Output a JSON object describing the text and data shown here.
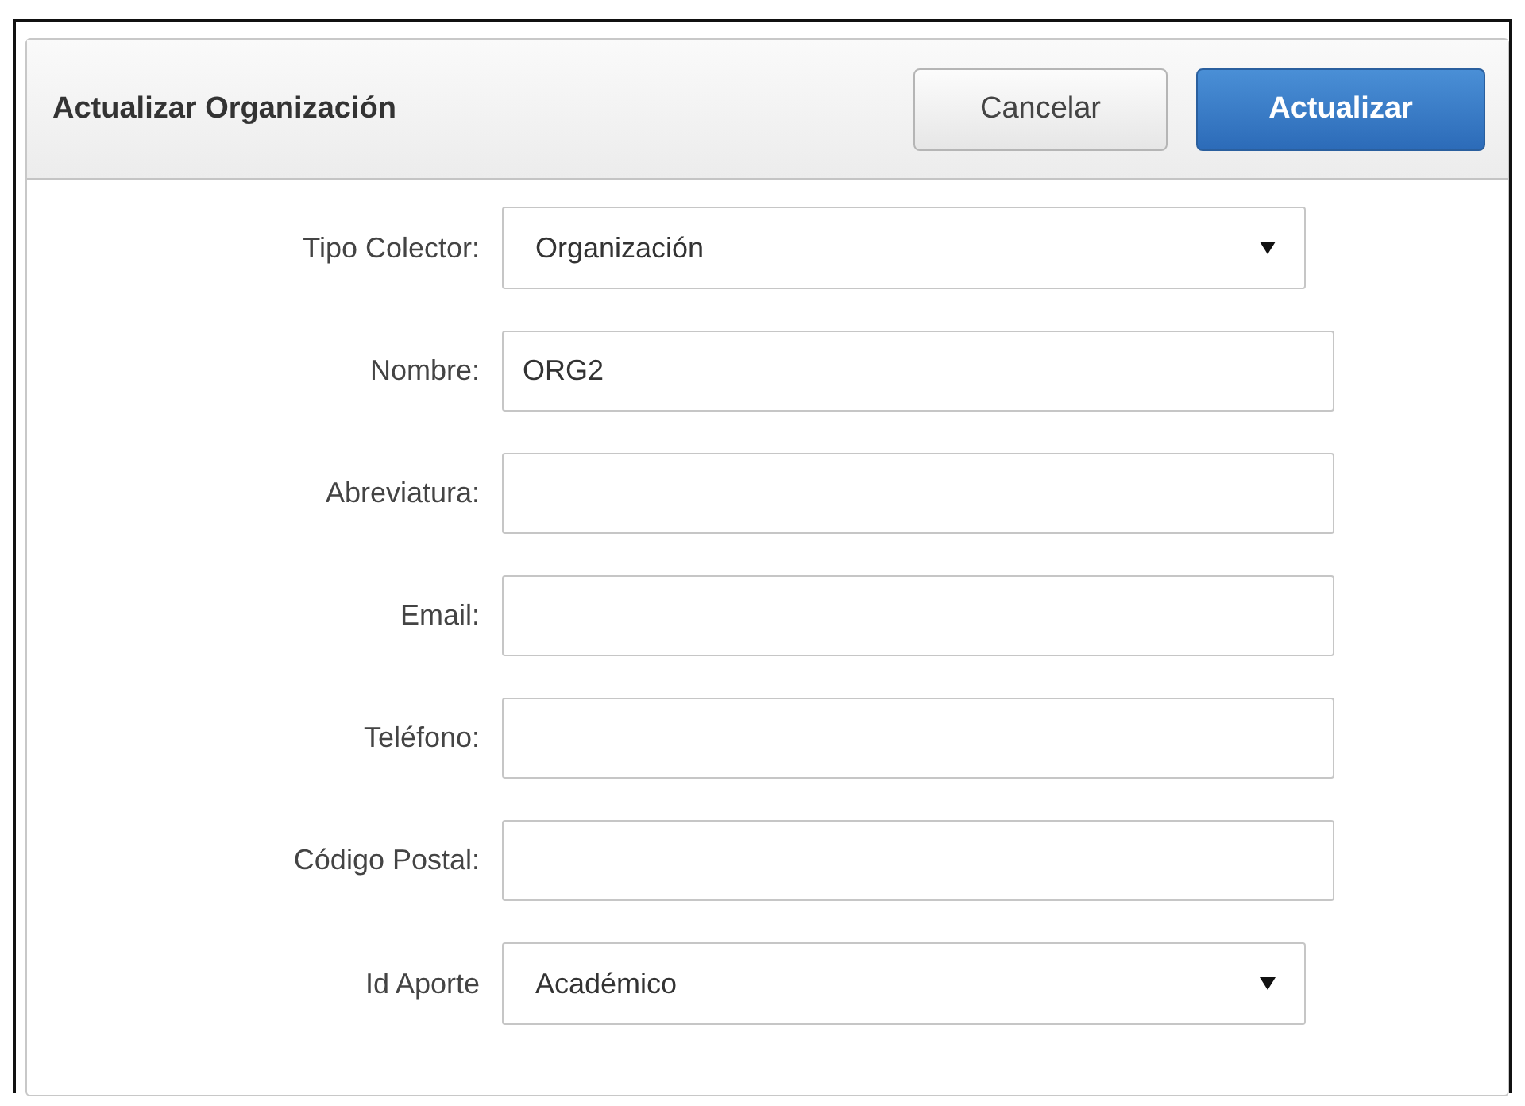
{
  "dialog": {
    "title": "Actualizar Organización"
  },
  "buttons": [
    {
      "label": "Cancelar",
      "kind": "default"
    },
    {
      "label": "Actualizar",
      "kind": "primary"
    }
  ],
  "fields": [
    {
      "label": "Tipo Colector:",
      "kind": "select",
      "value": "Organización"
    },
    {
      "label": "Nombre:",
      "kind": "text",
      "value": "ORG2"
    },
    {
      "label": "Abreviatura:",
      "kind": "text"
    },
    {
      "label": "Email:",
      "kind": "text"
    },
    {
      "label": "Teléfono:",
      "kind": "text"
    },
    {
      "label": "Código Postal:",
      "kind": "text"
    },
    {
      "label": "Id Aporte",
      "kind": "select",
      "value": "Académico"
    }
  ]
}
